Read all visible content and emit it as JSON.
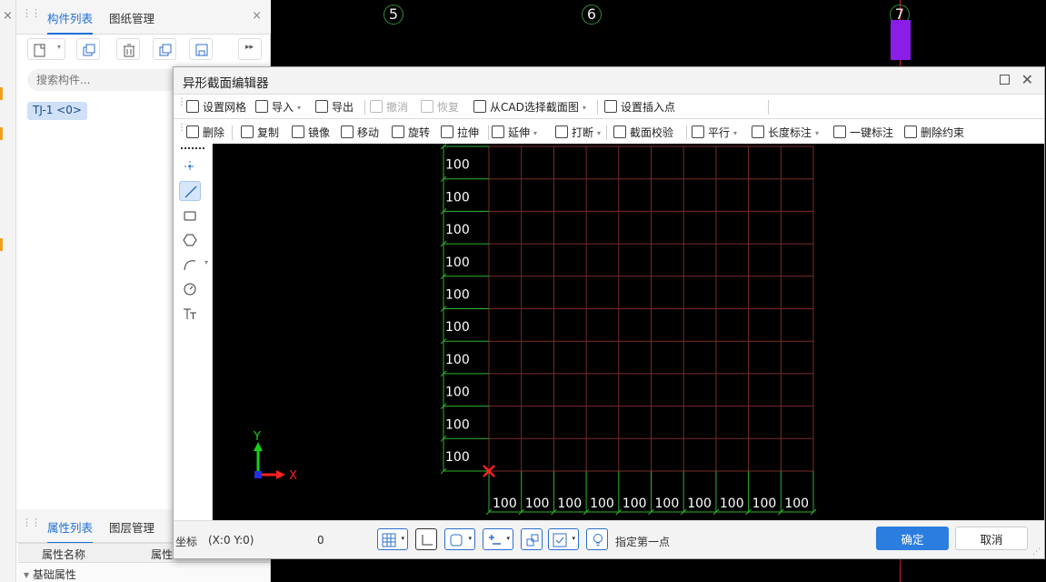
{
  "left_panel": {
    "tabs": [
      "构件列表",
      "图纸管理"
    ],
    "search_placeholder": "搜索构件...",
    "component": "TJ-1 <0>",
    "bottom_tabs": [
      "属性列表",
      "图层管理"
    ],
    "prop_header": [
      "属性名称",
      "属性"
    ],
    "prop_group": "基础属性"
  },
  "canvas": {
    "axis_labels": [
      "5",
      "6",
      "7"
    ],
    "accent_color": "#8a1ee8"
  },
  "dialog": {
    "title": "异形截面编辑器",
    "toolbar1": [
      {
        "label": "设置网格",
        "disabled": false,
        "dropdown": false
      },
      {
        "label": "导入",
        "disabled": false,
        "dropdown": true
      },
      {
        "label": "导出",
        "disabled": false,
        "dropdown": false
      },
      {
        "label": "撤消",
        "disabled": true,
        "dropdown": false
      },
      {
        "label": "恢复",
        "disabled": true,
        "dropdown": false
      },
      {
        "label": "从CAD选择截面图",
        "disabled": false,
        "dropdown": true
      },
      {
        "label": "设置插入点",
        "disabled": false,
        "dropdown": false
      }
    ],
    "toolbar2": [
      {
        "label": "删除",
        "dropdown": false
      },
      {
        "label": "复制",
        "dropdown": false
      },
      {
        "label": "镜像",
        "dropdown": false
      },
      {
        "label": "移动",
        "dropdown": false
      },
      {
        "label": "旋转",
        "dropdown": false
      },
      {
        "label": "拉伸",
        "dropdown": false
      },
      {
        "label": "延伸",
        "dropdown": true
      },
      {
        "label": "打断",
        "dropdown": true
      },
      {
        "label": "截面校验",
        "dropdown": false
      },
      {
        "label": "平行",
        "dropdown": true
      },
      {
        "label": "长度标注",
        "dropdown": true
      },
      {
        "label": "一键标注",
        "dropdown": false
      },
      {
        "label": "删除约束",
        "dropdown": false
      }
    ],
    "side_tools": [
      "point-icon",
      "line-icon",
      "rectangle-icon",
      "polygon-icon",
      "arc-icon",
      "circle-icon",
      "text-icon"
    ],
    "grid": {
      "rows": 10,
      "cols": 10,
      "row_labels": [
        "100",
        "100",
        "100",
        "100",
        "100",
        "100",
        "100",
        "100",
        "100",
        "100"
      ],
      "col_labels": [
        "100",
        "100",
        "100",
        "100",
        "100",
        "100",
        "100",
        "100",
        "100",
        "100"
      ],
      "line_color": "#7a2a2a",
      "dim_color": "#2fb12f",
      "origin_color": "#ff2020"
    },
    "axes": {
      "x_label": "X",
      "y_label": "Y"
    },
    "status": {
      "coord_label": "坐标",
      "coord_value": "(X:0 Y:0)",
      "count": "0",
      "hint": "指定第一点"
    },
    "ok_label": "确定",
    "cancel_label": "取消"
  }
}
